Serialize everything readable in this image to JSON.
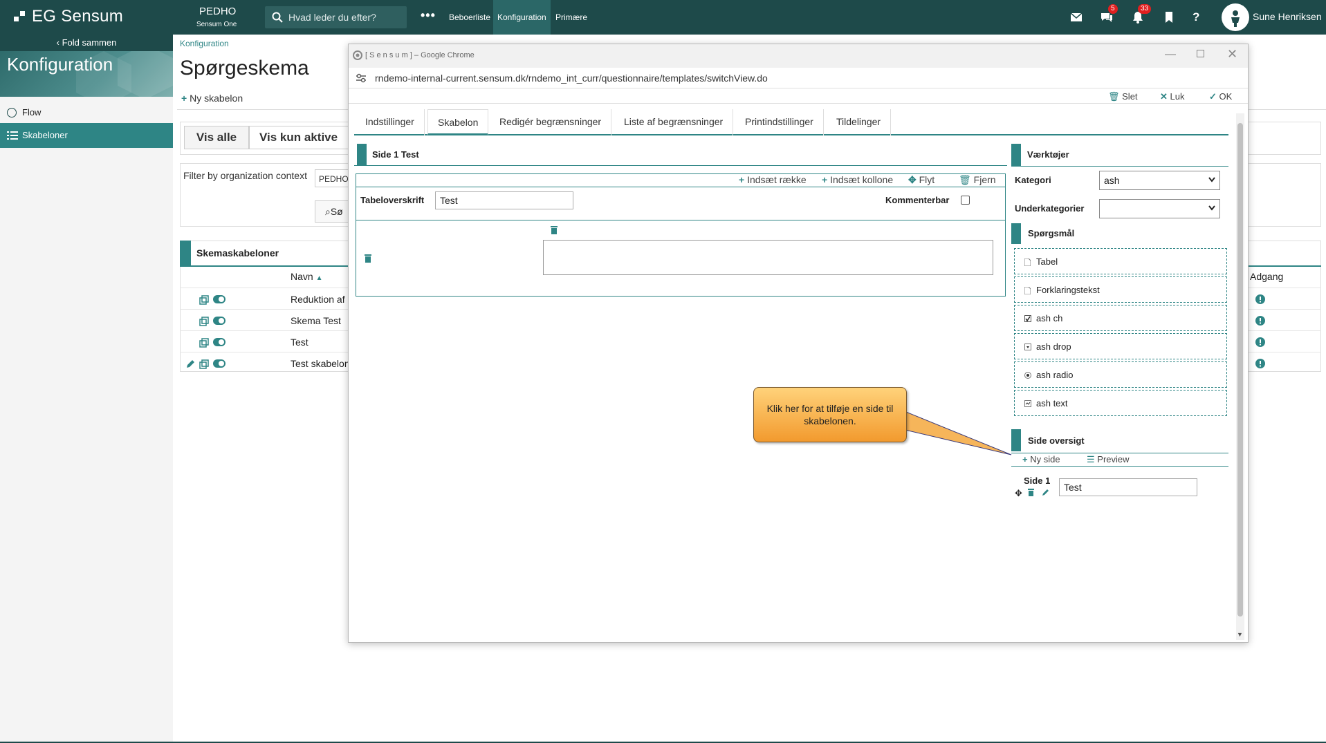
{
  "topbar": {
    "logo": "EG Sensum",
    "org_name": "PEDHO",
    "org_sub": "Sensum One",
    "search_placeholder": "Hvad leder du efter?",
    "nav": [
      "Beboerliste",
      "Konfiguration",
      "Primære"
    ],
    "messages_badge": "5",
    "notifications_badge": "33",
    "user_name": "Sune Henriksen"
  },
  "sidebar": {
    "fold": "Fold sammen",
    "title": "Konfiguration",
    "items": [
      {
        "label": "Flow"
      },
      {
        "label": "Skabeloner"
      }
    ]
  },
  "main": {
    "breadcrumb": "Konfiguration",
    "title": "Spørgeskema",
    "new_template": "Ny skabelon",
    "vis_alle": "Vis alle",
    "vis_kun_aktive": "Vis kun aktive",
    "filter_label": "Filter by organization context",
    "filter_value": "PEDHO",
    "search_btn": "Sø",
    "table_title": "Skemaskabeloner",
    "col_name": "Navn",
    "col_access": "Adgang",
    "rows": [
      {
        "name": "Reduktion af"
      },
      {
        "name": "Skema Test"
      },
      {
        "name": "Test"
      },
      {
        "name": "Test skabelon"
      }
    ]
  },
  "chrome": {
    "window_title": "[ S e n s u m ] – Google Chrome",
    "url": "rndemo-internal-current.sensum.dk/rndemo_int_curr/questionnaire/templates/switchView.do",
    "actions": {
      "delete": "Slet",
      "close": "Luk",
      "ok": "OK"
    },
    "tabs": [
      "Indstillinger",
      "Skabelon",
      "Redigér begrænsninger",
      "Liste af begrænsninger",
      "Printindstillinger",
      "Tildelinger"
    ],
    "side_header": "Side 1 Test",
    "table_tools": {
      "insert_row": "Indsæt række",
      "insert_col": "Indsæt kollone",
      "move": "Flyt",
      "remove": "Fjern"
    },
    "table_heading_label": "Tabeloverskrift",
    "table_heading_value": "Test",
    "commentable_label": "Kommenterbar",
    "tools_title": "Værktøjer",
    "category_label": "Kategori",
    "category_value": "ash",
    "subcategory_label": "Underkategorier",
    "questions_title": "Spørgsmål",
    "questions": [
      "Tabel",
      "Forklaringstekst",
      "ash ch",
      "ash drop",
      "ash radio",
      "ash text"
    ],
    "page_overview_title": "Side oversigt",
    "new_page": "Ny side",
    "preview": "Preview",
    "page_label": "Side 1",
    "page_value": "Test",
    "callout": "Klik her for at tilføje en side til skabelonen."
  },
  "colors": {
    "brand": "#1e4a4a",
    "accent": "#2e8585",
    "callout": "#f29a2e"
  }
}
